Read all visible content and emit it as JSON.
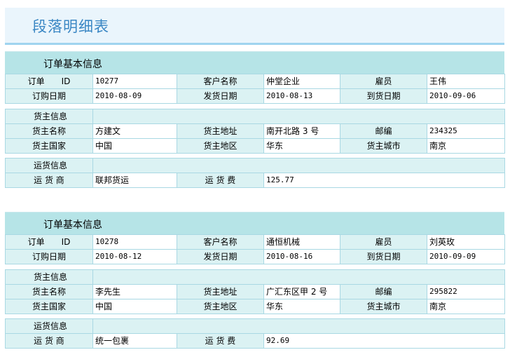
{
  "page": {
    "title": "段落明细表"
  },
  "labels": {
    "order_section": "订单基本信息",
    "order_id": "订单　　ID",
    "customer": "客户名称",
    "employee": "雇员",
    "order_date": "订购日期",
    "ship_date": "发货日期",
    "arrival_date": "到货日期",
    "shipper_section": "货主信息",
    "shipper_name": "货主名称",
    "shipper_address": "货主地址",
    "postcode": "邮编",
    "shipper_country": "货主国家",
    "shipper_region": "货主地区",
    "shipper_city": "货主城市",
    "shipping_section": "运货信息",
    "carrier": "运 货 商",
    "freight": "运 货 费"
  },
  "orders": [
    {
      "order_id": "10277",
      "customer": "仲堂企业",
      "employee": "王伟",
      "order_date": "2010-08-09",
      "ship_date": "2010-08-13",
      "arrival_date": "2010-09-06",
      "shipper_name": "方建文",
      "shipper_address": "南开北路 3 号",
      "postcode": "234325",
      "shipper_country": "中国",
      "shipper_region": "华东",
      "shipper_city": "南京",
      "carrier": "联邦货运",
      "freight": "125.77"
    },
    {
      "order_id": "10278",
      "customer": "通恒机械",
      "employee": "刘英玫",
      "order_date": "2010-08-12",
      "ship_date": "2010-08-16",
      "arrival_date": "2010-09-09",
      "shipper_name": "李先生",
      "shipper_address": "广汇东区甲 2 号",
      "postcode": "295822",
      "shipper_country": "中国",
      "shipper_region": "华东",
      "shipper_city": "南京",
      "carrier": "统一包裹",
      "freight": "92.69"
    }
  ]
}
